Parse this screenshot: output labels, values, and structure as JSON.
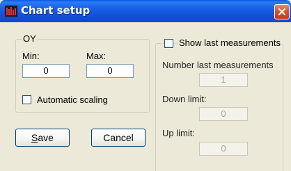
{
  "window": {
    "title": "Chart setup",
    "icon": "chart-bars-icon",
    "close_icon": "close-icon"
  },
  "oy_group": {
    "legend": "OY",
    "min_label": "Min:",
    "min_value": "0",
    "max_label": "Max:",
    "max_value": "0",
    "auto_scaling_label": "Automatic scaling",
    "auto_scaling_checked": false
  },
  "buttons": {
    "save_mnemonic": "S",
    "save_rest": "ave",
    "cancel_label": "Cancel"
  },
  "last_group": {
    "show_last_label": "Show last measurements",
    "show_last_checked": false,
    "number_last_label": "Number last measurements",
    "number_last_value": "1",
    "down_limit_label": "Down limit:",
    "down_limit_value": "0",
    "up_limit_label": "Up limit:",
    "up_limit_value": "0"
  },
  "colors": {
    "titlebar": "#0b4acb",
    "face": "#ece9d8",
    "close_button": "#d9532e"
  }
}
